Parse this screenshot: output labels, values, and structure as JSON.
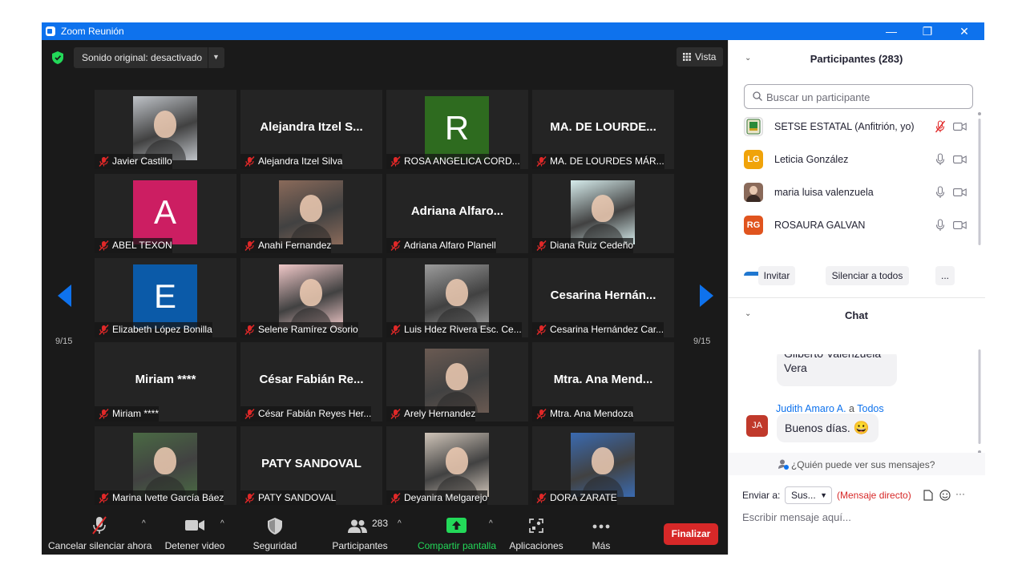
{
  "window": {
    "title": "Zoom Reunión",
    "controls": {
      "minimize": "—",
      "restore": "❐",
      "close": "✕"
    }
  },
  "meeting": {
    "audio_label": "Sonido original: desactivado",
    "view_label": "Vista",
    "page_left": "9/15",
    "page_right": "9/15",
    "tiles": [
      {
        "name": "Javier Castillo",
        "kind": "photo",
        "photo": "photo-javier",
        "color": "#bfc3c8"
      },
      {
        "name": "Alejandra Itzel Silva",
        "kind": "text",
        "big": "Alejandra Itzel S..."
      },
      {
        "name": "ROSA ANGELICA CORD...",
        "kind": "letter",
        "letter": "R",
        "color": "#2e6b1f"
      },
      {
        "name": "MA. DE LOURDES MÁR...",
        "kind": "text",
        "big": "MA. DE LOURDE..."
      },
      {
        "name": "ABEL TEXON",
        "kind": "letter",
        "letter": "A",
        "color": "#cc1e62"
      },
      {
        "name": "Anahi Fernandez",
        "kind": "photo",
        "photo": "photo-anahi",
        "color": "#8a6a5a"
      },
      {
        "name": "Adriana Alfaro Planell",
        "kind": "text",
        "big": "Adriana Alfaro..."
      },
      {
        "name": "Diana Ruiz Cedeño",
        "kind": "photo",
        "photo": "photo-diana",
        "color": "#d6ecec"
      },
      {
        "name": "Elizabeth López Bonilla",
        "kind": "letter",
        "letter": "E",
        "color": "#0b5aa8"
      },
      {
        "name": "Selene Ramírez Osorio",
        "kind": "photo",
        "photo": "photo-selene",
        "color": "#f0c8c8"
      },
      {
        "name": "Luis Hdez Rivera Esc. Ce...",
        "kind": "photo",
        "photo": "photo-luis",
        "color": "#9c9c9c"
      },
      {
        "name": "Cesarina Hernández Car...",
        "kind": "text",
        "big": "Cesarina Hernán..."
      },
      {
        "name": "Miriam ****",
        "kind": "text",
        "big": "Miriam ****"
      },
      {
        "name": "César Fabián Reyes Her...",
        "kind": "text",
        "big": "César Fabián Re..."
      },
      {
        "name": "Arely Hernandez",
        "kind": "photo",
        "photo": "photo-arely",
        "color": "#6a5a52"
      },
      {
        "name": "Mtra. Ana Mendoza",
        "kind": "text",
        "big": "Mtra. Ana Mend..."
      },
      {
        "name": "Marina Ivette García Báez",
        "kind": "photo",
        "photo": "photo-marina",
        "color": "#4a6a44"
      },
      {
        "name": "PATY SANDOVAL",
        "kind": "text",
        "big": "PATY SANDOVAL"
      },
      {
        "name": "Deyanira Melgarejo",
        "kind": "photo",
        "photo": "photo-deyanira",
        "color": "#cfc4b8"
      },
      {
        "name": "DORA ZARATE",
        "kind": "photo",
        "photo": "photo-dora",
        "color": "#3a6ab0"
      }
    ]
  },
  "toolbar": {
    "unmute": "Cancelar silenciar ahora",
    "stop_video": "Detener video",
    "security": "Seguridad",
    "participants": "Participantes",
    "participants_count": "283",
    "share_screen": "Compartir pantalla",
    "apps": "Aplicaciones",
    "more": "Más",
    "end": "Finalizar"
  },
  "participants_panel": {
    "title": "Participantes (283)",
    "search_placeholder": "Buscar un participante",
    "list": [
      {
        "name": "SETSE ESTATAL (Anfitrión, yo)",
        "initials": "",
        "color": "#f3f3f3",
        "mic_muted": true
      },
      {
        "name": "Leticia González",
        "initials": "LG",
        "color": "#f0a30a",
        "mic_muted": false
      },
      {
        "name": "maria luisa valenzuela",
        "initials": "",
        "color": "#8a6a5a",
        "mic_muted": false
      },
      {
        "name": "ROSAURA GALVAN",
        "initials": "RG",
        "color": "#e0541e",
        "mic_muted": false
      }
    ],
    "invite": "Invitar",
    "mute_all": "Silenciar a todos",
    "more": "..."
  },
  "chat": {
    "title": "Chat",
    "prev_message": "Gilberto Valenzuela Vera",
    "sender": "Judith Amaro A.",
    "to_word": "a",
    "recipient_all": "Todos",
    "sender_initials": "JA",
    "message": "Buenos días.",
    "emoji": "😀",
    "who_can_see": "¿Quién puede ver sus mensajes?",
    "send_to_label": "Enviar a:",
    "send_to_value": "Sus...",
    "direct_message": "(Mensaje directo)",
    "more": "···",
    "input_placeholder": "Escribir mensaje aquí..."
  }
}
